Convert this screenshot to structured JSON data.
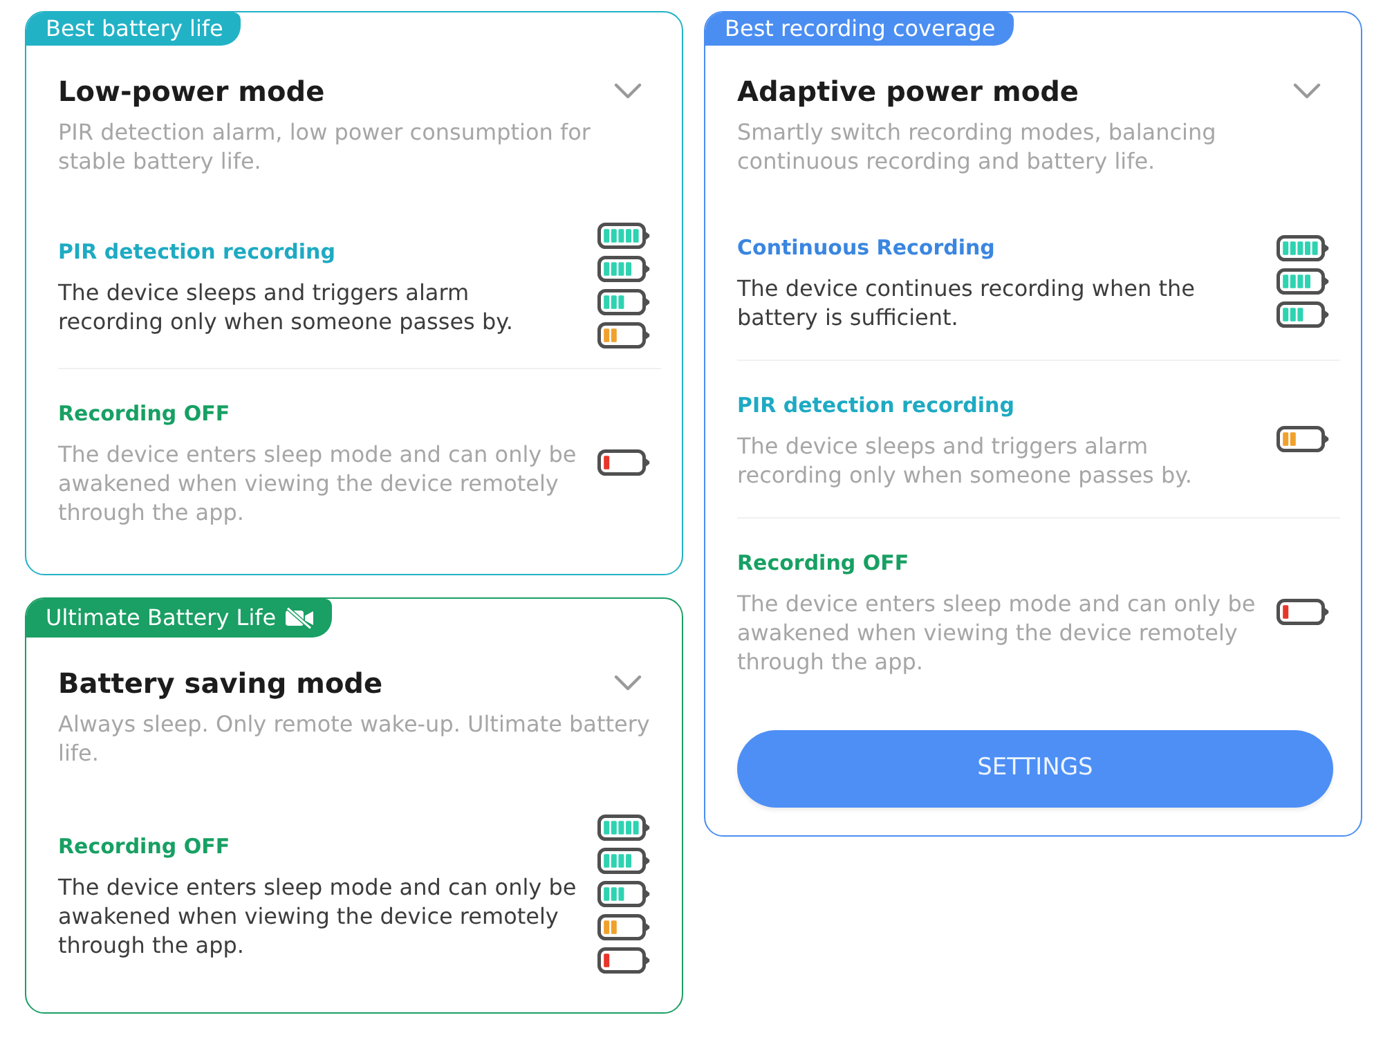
{
  "columns": [
    {
      "cards": [
        {
          "color": "#22b2c6",
          "tag": {
            "text": "Best battery life",
            "has_icon": false
          },
          "title": "Low-power mode",
          "description": "PIR detection alarm, low power consumption for stable battery life.",
          "options": [
            {
              "title": "PIR detection recording",
              "color": "#1eaac2",
              "description": "The device sleeps and triggers alarm recording only when someone passes by.",
              "dimmed": false,
              "batteries": [
                {
                  "kind": "full"
                },
                {
                  "kind": "high"
                },
                {
                  "kind": "medium"
                },
                {
                  "kind": "low"
                }
              ]
            },
            {
              "title": "Recording OFF",
              "color": "#17a063",
              "description": "The device enters sleep mode and can only be awakened when viewing the device remotely through the app.",
              "dimmed": true,
              "batteries": [
                {
                  "kind": "critical"
                }
              ]
            }
          ]
        },
        {
          "color": "#1a9f64",
          "tag": {
            "text": "Ultimate Battery Life",
            "has_icon": true
          },
          "title": "Battery saving mode",
          "description": "Always sleep. Only remote wake-up. Ultimate battery life.",
          "options": [
            {
              "title": "Recording OFF",
              "color": "#17a063",
              "description": "The device enters sleep mode and can only be awakened when viewing the device remotely through the app.",
              "dimmed": false,
              "batteries": [
                {
                  "kind": "full"
                },
                {
                  "kind": "high"
                },
                {
                  "kind": "medium"
                },
                {
                  "kind": "low"
                },
                {
                  "kind": "critical"
                }
              ]
            }
          ]
        }
      ]
    },
    {
      "cards": [
        {
          "color": "#4b8ef2",
          "tag": {
            "text": "Best recording coverage",
            "has_icon": false
          },
          "title": "Adaptive power mode",
          "description": "Smartly switch recording modes, balancing continuous recording and battery life.",
          "options": [
            {
              "title": "Continuous Recording",
              "color": "#3a86e0",
              "description": "The device continues recording when the battery is sufficient.",
              "dimmed": false,
              "batteries": [
                {
                  "kind": "full"
                },
                {
                  "kind": "high"
                },
                {
                  "kind": "medium"
                }
              ]
            },
            {
              "title": "PIR detection recording",
              "color": "#1eaac2",
              "description": "The device sleeps and triggers alarm recording only when someone passes by.",
              "dimmed": true,
              "batteries": [
                {
                  "kind": "low"
                }
              ]
            },
            {
              "title": "Recording OFF",
              "color": "#17a063",
              "description": "The device enters sleep mode and can only be awakened when viewing the device remotely through the app.",
              "dimmed": true,
              "batteries": [
                {
                  "kind": "critical"
                }
              ]
            }
          ],
          "button": {
            "label": "SETTINGS"
          }
        }
      ]
    }
  ]
}
